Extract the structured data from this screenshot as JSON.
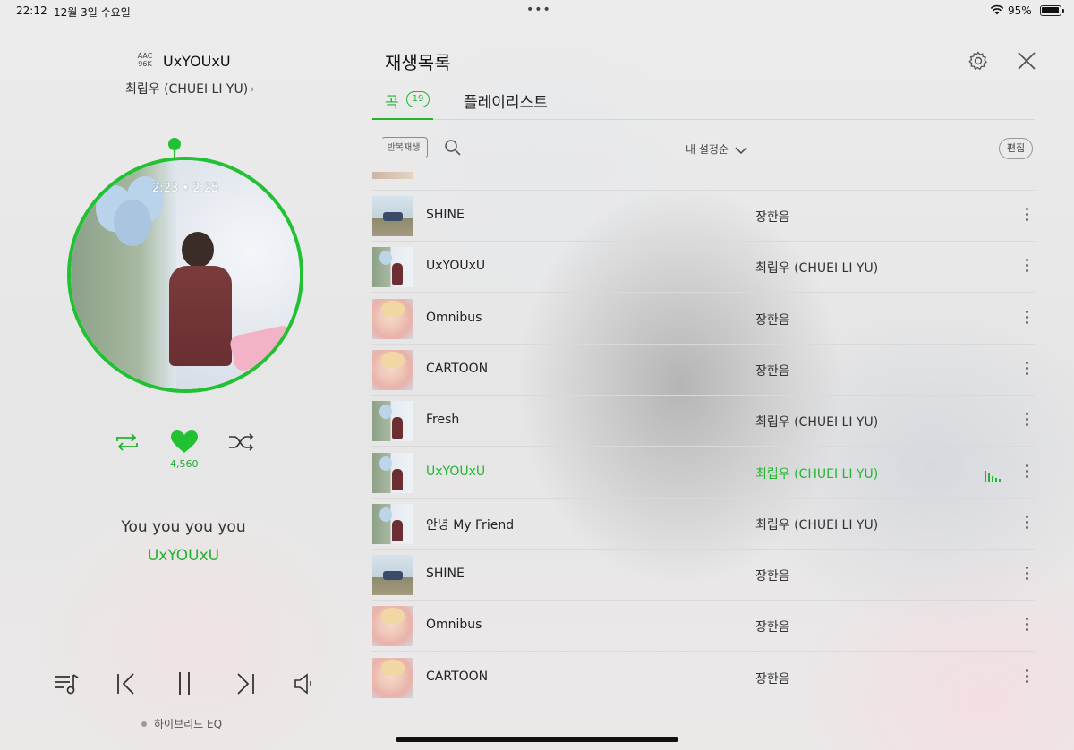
{
  "status_bar": {
    "time": "22:12",
    "date": "12월 3일 수요일",
    "dots": "•••",
    "battery_pct": "95%"
  },
  "player": {
    "codec": "AAC\n96K",
    "codec_top": "AAC",
    "codec_bottom": "96K",
    "title": "UxYOUxU",
    "artist": "최립우 (CHUEI LI YU)",
    "elapsed": "2:23 • 2:25",
    "like_count": "4,560",
    "lyric_line": "You you you you",
    "lyric_track": "UxYOUxU",
    "eq_label": "하이브리드 EQ",
    "accent_color": "#22c134"
  },
  "playlist": {
    "title": "재생목록",
    "tabs": {
      "songs_label": "곡",
      "songs_count": "19",
      "playlists_label": "플레이리스트"
    },
    "toolbar": {
      "repeat_label": "반복재생",
      "sort_label": "내 설정순",
      "edit_label": "편집"
    },
    "rows": [
      {
        "title": "SHINE",
        "artist": "장한음",
        "thumb": "sky",
        "active": false
      },
      {
        "title": "UxYOUxU",
        "artist": "최립우 (CHUEI LI YU)",
        "thumb": "balloon",
        "active": false
      },
      {
        "title": "Omnibus",
        "artist": "장한음",
        "thumb": "pink",
        "active": false
      },
      {
        "title": "CARTOON",
        "artist": "장한음",
        "thumb": "pink",
        "active": false
      },
      {
        "title": "Fresh",
        "artist": "최립우 (CHUEI LI YU)",
        "thumb": "balloon",
        "active": false
      },
      {
        "title": "UxYOUxU",
        "artist": "최립우 (CHUEI LI YU)",
        "thumb": "balloon",
        "active": true
      },
      {
        "title": "안녕 My Friend",
        "artist": "최립우 (CHUEI LI YU)",
        "thumb": "balloon",
        "active": false
      },
      {
        "title": "SHINE",
        "artist": "장한음",
        "thumb": "sky",
        "active": false
      },
      {
        "title": "Omnibus",
        "artist": "장한음",
        "thumb": "pink",
        "active": false
      },
      {
        "title": "CARTOON",
        "artist": "장한음",
        "thumb": "pink",
        "active": false
      }
    ],
    "accent_color": "#21b530"
  }
}
